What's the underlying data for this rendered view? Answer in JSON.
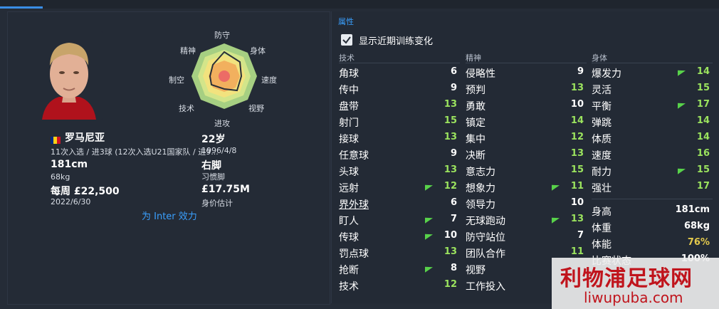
{
  "colors": {
    "accent": "#3aa0ff",
    "val_white": "#ffffff",
    "val_green": "#58d24a",
    "val_light_green": "#9be35e",
    "val_yellow": "#e3c94c",
    "bg": "#252c37"
  },
  "player": {
    "name": "罗马尼亚",
    "caps": "11次入选 / 进3球 (12次入选U21国家队 / 进9...",
    "height": "181cm",
    "weight": "68kg",
    "wage": "每周 £22,500",
    "contract_end": "2022/6/30",
    "age": "22岁",
    "dob": "1996/4/8",
    "foot": "右脚",
    "foot_label": "习惯脚",
    "value": "£17.75M",
    "value_label": "身价估计",
    "club_link": "为 Inter 效力"
  },
  "radar": {
    "labels": [
      "防守",
      "身体",
      "速度",
      "视野",
      "进攻",
      "技术",
      "制空",
      "精神"
    ]
  },
  "attributes_panel": {
    "section_title": "属性",
    "show_training_label": "显示近期训练变化",
    "show_training_checked": true,
    "columns": [
      {
        "title": "技术",
        "rows": [
          {
            "name": "角球",
            "value": "6",
            "color": "white",
            "arrow": false
          },
          {
            "name": "传中",
            "value": "9",
            "color": "white",
            "arrow": false
          },
          {
            "name": "盘带",
            "value": "13",
            "color": "green",
            "arrow": false
          },
          {
            "name": "射门",
            "value": "15",
            "color": "green",
            "arrow": false
          },
          {
            "name": "接球",
            "value": "13",
            "color": "green",
            "arrow": false
          },
          {
            "name": "任意球",
            "value": "9",
            "color": "white",
            "arrow": false
          },
          {
            "name": "头球",
            "value": "13",
            "color": "green",
            "arrow": false
          },
          {
            "name": "远射",
            "value": "12",
            "color": "green",
            "arrow": true
          },
          {
            "name": "界外球",
            "value": "6",
            "color": "white",
            "arrow": false,
            "underline": true
          },
          {
            "name": "盯人",
            "value": "7",
            "color": "white",
            "arrow": true
          },
          {
            "name": "传球",
            "value": "10",
            "color": "white",
            "arrow": true
          },
          {
            "name": "罚点球",
            "value": "13",
            "color": "green",
            "arrow": false
          },
          {
            "name": "抢断",
            "value": "8",
            "color": "white",
            "arrow": true
          },
          {
            "name": "技术",
            "value": "12",
            "color": "green",
            "arrow": false
          }
        ]
      },
      {
        "title": "精神",
        "rows": [
          {
            "name": "侵略性",
            "value": "9",
            "color": "white",
            "arrow": false
          },
          {
            "name": "预判",
            "value": "13",
            "color": "green",
            "arrow": false
          },
          {
            "name": "勇敢",
            "value": "10",
            "color": "white",
            "arrow": false
          },
          {
            "name": "镇定",
            "value": "14",
            "color": "green",
            "arrow": false
          },
          {
            "name": "集中",
            "value": "12",
            "color": "green",
            "arrow": false
          },
          {
            "name": "决断",
            "value": "13",
            "color": "green",
            "arrow": false
          },
          {
            "name": "意志力",
            "value": "15",
            "color": "green",
            "arrow": false
          },
          {
            "name": "想象力",
            "value": "11",
            "color": "green",
            "arrow": true
          },
          {
            "name": "领导力",
            "value": "10",
            "color": "white",
            "arrow": false
          },
          {
            "name": "无球跑动",
            "value": "13",
            "color": "green",
            "arrow": true
          },
          {
            "name": "防守站位",
            "value": "7",
            "color": "white",
            "arrow": false
          },
          {
            "name": "团队合作",
            "value": "11",
            "color": "green",
            "arrow": false
          },
          {
            "name": "视野",
            "value": "",
            "color": "white",
            "arrow": false
          },
          {
            "name": "工作投入",
            "value": "",
            "color": "white",
            "arrow": false
          }
        ]
      },
      {
        "title": "身体",
        "rows": [
          {
            "name": "爆发力",
            "value": "14",
            "color": "green",
            "arrow": true
          },
          {
            "name": "灵活",
            "value": "15",
            "color": "green",
            "arrow": false
          },
          {
            "name": "平衡",
            "value": "17",
            "color": "green",
            "arrow": true
          },
          {
            "name": "弹跳",
            "value": "14",
            "color": "green",
            "arrow": false
          },
          {
            "name": "体质",
            "value": "14",
            "color": "green",
            "arrow": false
          },
          {
            "name": "速度",
            "value": "16",
            "color": "green",
            "arrow": false
          },
          {
            "name": "耐力",
            "value": "15",
            "color": "green",
            "arrow": true
          },
          {
            "name": "强壮",
            "value": "17",
            "color": "green",
            "arrow": false
          }
        ],
        "extra": [
          {
            "name": "身高",
            "value": "181cm",
            "color": "white"
          },
          {
            "name": "体重",
            "value": "68kg",
            "color": "white"
          },
          {
            "name": "体能",
            "value": "76%",
            "color": "yellow"
          },
          {
            "name": "比赛状态",
            "value": "100%",
            "color": "white"
          }
        ]
      }
    ]
  },
  "watermark": {
    "text": "利物浦足球网",
    "url": "liwupuba.com"
  }
}
